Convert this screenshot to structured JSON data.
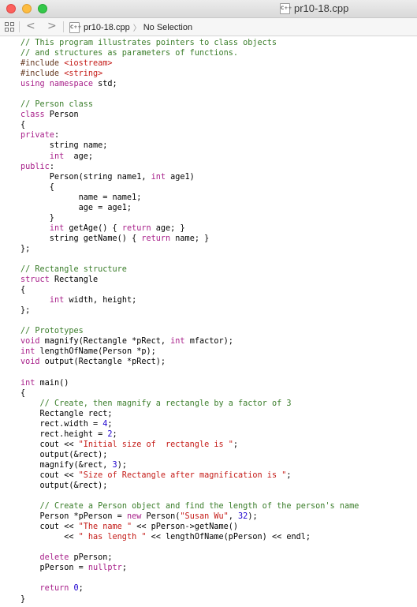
{
  "window": {
    "title": "pr10-18.cpp",
    "title_icon_label": "C++"
  },
  "toolbar": {
    "back_glyph": "<",
    "forward_glyph": ">",
    "file_icon_label": "C++",
    "file_name": "pr10-18.cpp",
    "chevron_glyph": "〉",
    "selection": "No Selection"
  },
  "colors": {
    "comment": "#3a7d2a",
    "keyword": "#a8208a",
    "string": "#c41a16",
    "number": "#1c00cf",
    "macro": "#643820",
    "plain": "#000000"
  },
  "code": [
    [
      [
        "c",
        "// This program illustrates pointers to class objects"
      ]
    ],
    [
      [
        "c",
        "// and structures as parameters of functions."
      ]
    ],
    [
      [
        "m",
        "#include "
      ],
      [
        "s",
        "<iostream>"
      ]
    ],
    [
      [
        "m",
        "#include "
      ],
      [
        "s",
        "<string>"
      ]
    ],
    [
      [
        "k",
        "using namespace"
      ],
      [
        "p",
        " std;"
      ]
    ],
    [],
    [
      [
        "c",
        "// Person class"
      ]
    ],
    [
      [
        "k",
        "class"
      ],
      [
        "p",
        " Person"
      ]
    ],
    [
      [
        "p",
        "{"
      ]
    ],
    [
      [
        "k",
        "private"
      ],
      [
        "p",
        ":"
      ]
    ],
    [
      [
        "p",
        "      string name;"
      ]
    ],
    [
      [
        "p",
        "      "
      ],
      [
        "k",
        "int"
      ],
      [
        "p",
        "  age;"
      ]
    ],
    [
      [
        "k",
        "public"
      ],
      [
        "p",
        ":"
      ]
    ],
    [
      [
        "p",
        "      Person(string name1, "
      ],
      [
        "k",
        "int"
      ],
      [
        "p",
        " age1)"
      ]
    ],
    [
      [
        "p",
        "      {"
      ]
    ],
    [
      [
        "p",
        "            name = name1;"
      ]
    ],
    [
      [
        "p",
        "            age = age1;"
      ]
    ],
    [
      [
        "p",
        "      }"
      ]
    ],
    [
      [
        "p",
        "      "
      ],
      [
        "k",
        "int"
      ],
      [
        "p",
        " getAge() { "
      ],
      [
        "k",
        "return"
      ],
      [
        "p",
        " age; }"
      ]
    ],
    [
      [
        "p",
        "      string getName() { "
      ],
      [
        "k",
        "return"
      ],
      [
        "p",
        " name; }"
      ]
    ],
    [
      [
        "p",
        "};"
      ]
    ],
    [],
    [
      [
        "c",
        "// Rectangle structure"
      ]
    ],
    [
      [
        "k",
        "struct"
      ],
      [
        "p",
        " Rectangle"
      ]
    ],
    [
      [
        "p",
        "{"
      ]
    ],
    [
      [
        "p",
        "      "
      ],
      [
        "k",
        "int"
      ],
      [
        "p",
        " width, height;"
      ]
    ],
    [
      [
        "p",
        "};"
      ]
    ],
    [],
    [
      [
        "c",
        "// Prototypes"
      ]
    ],
    [
      [
        "k",
        "void"
      ],
      [
        "p",
        " magnify(Rectangle *pRect, "
      ],
      [
        "k",
        "int"
      ],
      [
        "p",
        " mfactor);"
      ]
    ],
    [
      [
        "k",
        "int"
      ],
      [
        "p",
        " lengthOfName(Person *p);"
      ]
    ],
    [
      [
        "k",
        "void"
      ],
      [
        "p",
        " output(Rectangle *pRect);"
      ]
    ],
    [],
    [
      [
        "k",
        "int"
      ],
      [
        "p",
        " main()"
      ]
    ],
    [
      [
        "p",
        "{"
      ]
    ],
    [
      [
        "p",
        "    "
      ],
      [
        "c",
        "// Create, then magnify a rectangle by a factor of 3"
      ]
    ],
    [
      [
        "p",
        "    Rectangle rect;"
      ]
    ],
    [
      [
        "p",
        "    rect.width = "
      ],
      [
        "n",
        "4"
      ],
      [
        "p",
        ";"
      ]
    ],
    [
      [
        "p",
        "    rect.height = "
      ],
      [
        "n",
        "2"
      ],
      [
        "p",
        ";"
      ]
    ],
    [
      [
        "p",
        "    cout << "
      ],
      [
        "s",
        "\"Initial size of  rectangle is \""
      ],
      [
        "p",
        ";"
      ]
    ],
    [
      [
        "p",
        "    output(&rect);"
      ]
    ],
    [
      [
        "p",
        "    magnify(&rect, "
      ],
      [
        "n",
        "3"
      ],
      [
        "p",
        ");"
      ]
    ],
    [
      [
        "p",
        "    cout << "
      ],
      [
        "s",
        "\"Size of Rectangle after magnification is \""
      ],
      [
        "p",
        ";"
      ]
    ],
    [
      [
        "p",
        "    output(&rect);"
      ]
    ],
    [],
    [
      [
        "p",
        "    "
      ],
      [
        "c",
        "// Create a Person object and find the length of the person's name"
      ]
    ],
    [
      [
        "p",
        "    Person *pPerson = "
      ],
      [
        "k",
        "new"
      ],
      [
        "p",
        " Person("
      ],
      [
        "s",
        "\"Susan Wu\""
      ],
      [
        "p",
        ", "
      ],
      [
        "n",
        "32"
      ],
      [
        "p",
        ");"
      ]
    ],
    [
      [
        "p",
        "    cout << "
      ],
      [
        "s",
        "\"The name \""
      ],
      [
        "p",
        " << pPerson->getName()"
      ]
    ],
    [
      [
        "p",
        "         << "
      ],
      [
        "s",
        "\" has length \""
      ],
      [
        "p",
        " << lengthOfName(pPerson) << endl;"
      ]
    ],
    [],
    [
      [
        "p",
        "    "
      ],
      [
        "k",
        "delete"
      ],
      [
        "p",
        " pPerson;"
      ]
    ],
    [
      [
        "p",
        "    pPerson = "
      ],
      [
        "k",
        "nullptr"
      ],
      [
        "p",
        ";"
      ]
    ],
    [],
    [
      [
        "p",
        "    "
      ],
      [
        "k",
        "return"
      ],
      [
        "p",
        " "
      ],
      [
        "n",
        "0"
      ],
      [
        "p",
        ";"
      ]
    ],
    [
      [
        "p",
        "}"
      ]
    ]
  ]
}
